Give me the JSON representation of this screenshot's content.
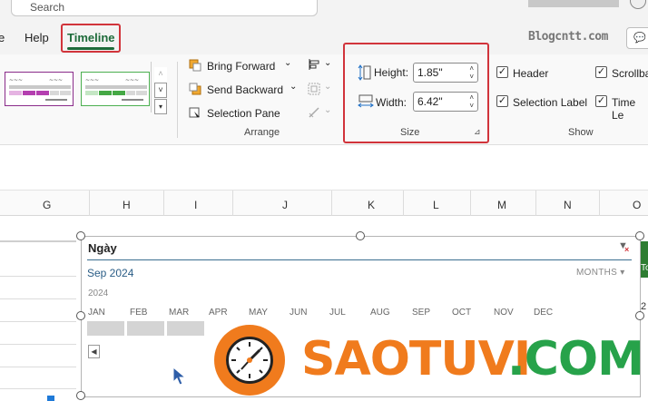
{
  "topbar": {
    "search_placeholder": "Search",
    "tabs": {
      "partial": "e",
      "help": "Help",
      "timeline": "Timeline"
    },
    "watermark": "Blogcntt.com",
    "comment_glyph": "💬"
  },
  "ribbon": {
    "arrange": {
      "bring_forward": "Bring Forward",
      "send_backward": "Send Backward",
      "selection_pane": "Selection Pane",
      "label": "Arrange"
    },
    "size": {
      "height_label": "Height:",
      "height_value": "1.85\"",
      "width_label": "Width:",
      "width_value": "6.42\"",
      "label": "Size"
    },
    "show": {
      "header": "Header",
      "selection_label": "Selection Label",
      "scrollbar": "Scrollbar",
      "time_level": "Time Le",
      "label": "Show"
    }
  },
  "columns": [
    "G",
    "H",
    "I",
    "J",
    "K",
    "L",
    "M",
    "N",
    "O"
  ],
  "timeline": {
    "title": "Ngày",
    "date_range": "Sep 2024",
    "level": "MONTHS",
    "year": "2024",
    "months": [
      "JAN",
      "FEB",
      "MAR",
      "APR",
      "MAY",
      "JUN",
      "JUL",
      "AUG",
      "SEP",
      "OCT",
      "NOV",
      "DEC"
    ]
  },
  "edge": {
    "green_text": "To",
    "number": "2"
  },
  "logo": {
    "part1": "SAOTUVI",
    "part2": ".COM"
  },
  "colors": {
    "accent_red": "#d1343b",
    "excel_green": "#1e6b3a",
    "logo_orange": "#f07b1d",
    "logo_green": "#27a24a"
  }
}
